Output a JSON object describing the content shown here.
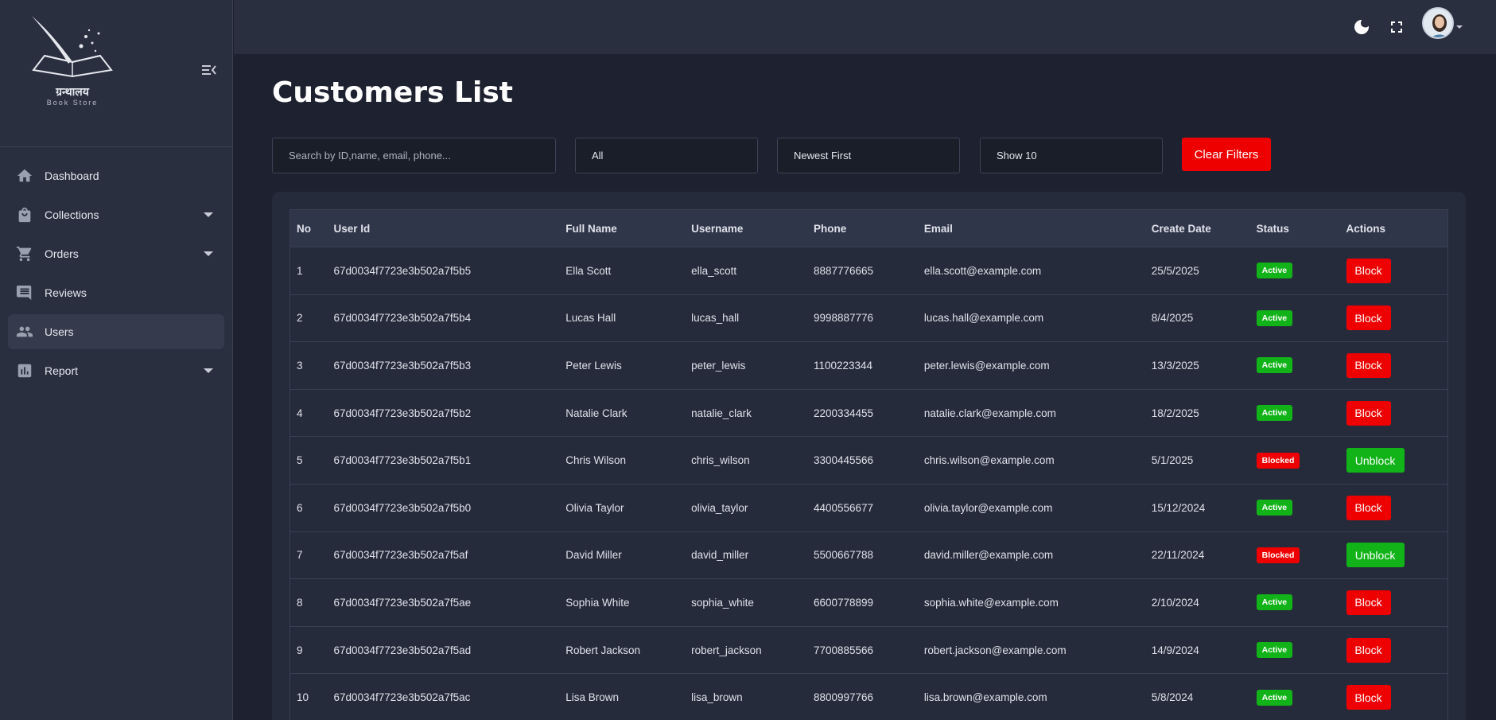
{
  "brand": {
    "title": "ग्रन्थालय",
    "subtitle": "Book Store"
  },
  "sidebar": {
    "items": [
      {
        "label": "Dashboard",
        "icon": "home-icon",
        "has_submenu": false,
        "active": false
      },
      {
        "label": "Collections",
        "icon": "bag-icon",
        "has_submenu": true,
        "active": false
      },
      {
        "label": "Orders",
        "icon": "cart-icon",
        "has_submenu": true,
        "active": false
      },
      {
        "label": "Reviews",
        "icon": "comment-icon",
        "has_submenu": false,
        "active": false
      },
      {
        "label": "Users",
        "icon": "people-icon",
        "has_submenu": false,
        "active": true
      },
      {
        "label": "Report",
        "icon": "chart-icon",
        "has_submenu": true,
        "active": false
      }
    ]
  },
  "topbar": {
    "icons": [
      "moon-icon",
      "fullscreen-icon"
    ]
  },
  "page": {
    "title": "Customers List"
  },
  "filters": {
    "search_placeholder": "Search by ID,name, email, phone...",
    "status": "All",
    "sort": "Newest First",
    "show": "Show 10",
    "clear_label": "Clear Filters"
  },
  "table": {
    "headers": [
      "No",
      "User Id",
      "Full Name",
      "Username",
      "Phone",
      "Email",
      "Create Date",
      "Status",
      "Actions"
    ],
    "rows": [
      {
        "no": "1",
        "id": "67d0034f7723e3b502a7f5b5",
        "name": "Ella Scott",
        "username": "ella_scott",
        "phone": "8887776665",
        "email": "ella.scott@example.com",
        "date": "25/5/2025",
        "status": "Active",
        "action": "Block"
      },
      {
        "no": "2",
        "id": "67d0034f7723e3b502a7f5b4",
        "name": "Lucas Hall",
        "username": "lucas_hall",
        "phone": "9998887776",
        "email": "lucas.hall@example.com",
        "date": "8/4/2025",
        "status": "Active",
        "action": "Block"
      },
      {
        "no": "3",
        "id": "67d0034f7723e3b502a7f5b3",
        "name": "Peter Lewis",
        "username": "peter_lewis",
        "phone": "1100223344",
        "email": "peter.lewis@example.com",
        "date": "13/3/2025",
        "status": "Active",
        "action": "Block"
      },
      {
        "no": "4",
        "id": "67d0034f7723e3b502a7f5b2",
        "name": "Natalie Clark",
        "username": "natalie_clark",
        "phone": "2200334455",
        "email": "natalie.clark@example.com",
        "date": "18/2/2025",
        "status": "Active",
        "action": "Block"
      },
      {
        "no": "5",
        "id": "67d0034f7723e3b502a7f5b1",
        "name": "Chris Wilson",
        "username": "chris_wilson",
        "phone": "3300445566",
        "email": "chris.wilson@example.com",
        "date": "5/1/2025",
        "status": "Blocked",
        "action": "Unblock"
      },
      {
        "no": "6",
        "id": "67d0034f7723e3b502a7f5b0",
        "name": "Olivia Taylor",
        "username": "olivia_taylor",
        "phone": "4400556677",
        "email": "olivia.taylor@example.com",
        "date": "15/12/2024",
        "status": "Active",
        "action": "Block"
      },
      {
        "no": "7",
        "id": "67d0034f7723e3b502a7f5af",
        "name": "David Miller",
        "username": "david_miller",
        "phone": "5500667788",
        "email": "david.miller@example.com",
        "date": "22/11/2024",
        "status": "Blocked",
        "action": "Unblock"
      },
      {
        "no": "8",
        "id": "67d0034f7723e3b502a7f5ae",
        "name": "Sophia White",
        "username": "sophia_white",
        "phone": "6600778899",
        "email": "sophia.white@example.com",
        "date": "2/10/2024",
        "status": "Active",
        "action": "Block"
      },
      {
        "no": "9",
        "id": "67d0034f7723e3b502a7f5ad",
        "name": "Robert Jackson",
        "username": "robert_jackson",
        "phone": "7700885566",
        "email": "robert.jackson@example.com",
        "date": "14/9/2024",
        "status": "Active",
        "action": "Block"
      },
      {
        "no": "10",
        "id": "67d0034f7723e3b502a7f5ac",
        "name": "Lisa Brown",
        "username": "lisa_brown",
        "phone": "8800997766",
        "email": "lisa.brown@example.com",
        "date": "5/8/2024",
        "status": "Active",
        "action": "Block"
      }
    ]
  },
  "colors": {
    "active": "#12b318",
    "blocked": "#ee0000"
  }
}
